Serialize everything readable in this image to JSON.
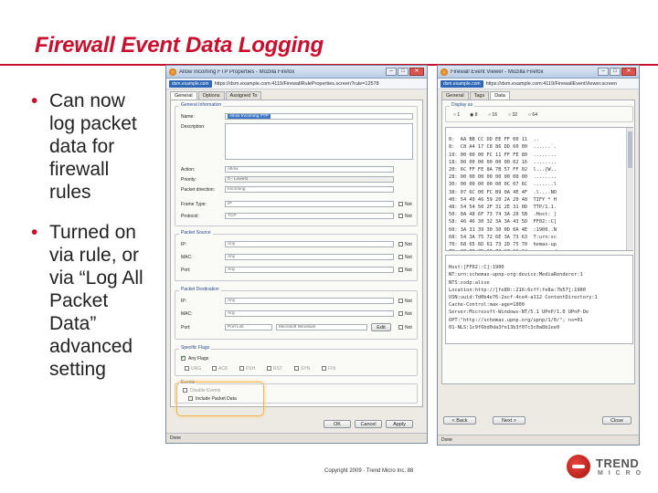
{
  "slide": {
    "title": "Firewall Event Data Logging",
    "bullets": [
      [
        "Can now",
        "log packet",
        "data for",
        "firewall",
        "rules"
      ],
      [
        "Turned on",
        "via rule, or",
        "via “Log All",
        "Packet",
        "Data”",
        "advanced",
        "setting"
      ]
    ],
    "copyright": "Copyright 2009 · Trend Micro Inc.   88",
    "logo": {
      "line1": "TREND",
      "line2": "M I C R O"
    }
  },
  "colors": {
    "accent": "#c8102e",
    "highlight": "#f0b44c"
  },
  "props_window": {
    "title": "Allow Incoming FTP Properties - Mozilla Firefox",
    "url_badge": "dsm.example.com",
    "url": "https://dsm.example.com:4119/FirewallRuleProperties.screen?rule=12578",
    "tabs": [
      "General",
      "Options",
      "Assigned To"
    ],
    "groups": {
      "general": "General Information",
      "source": "Packet Source",
      "destination": "Packet Destination",
      "flags": "Specific Flags",
      "events": "Events"
    },
    "fields": {
      "name_label": "Name:",
      "name_value": "Allow Incoming FTP",
      "desc_label": "Description:",
      "action_label": "Action:",
      "action_value": "Allow",
      "priority_label": "Priority:",
      "priority_value": "0 - Lowest",
      "direction_label": "Packet direction:",
      "direction_value": "Incoming",
      "frame_label": "Frame Type:",
      "frame_value": "IP",
      "protocol_label": "Protocol:",
      "protocol_value": "TCP",
      "not_label": "Not",
      "src_ip_label": "IP:",
      "src_ip_value": "Any",
      "src_mac_label": "MAC:",
      "src_mac_value": "Any",
      "src_port_label": "Port:",
      "src_port_value": "Any",
      "dst_ip_label": "IP:",
      "dst_ip_value": "Any",
      "dst_mac_label": "MAC:",
      "dst_mac_value": "Any",
      "dst_port_label": "Port:",
      "dst_port_value": "Port List",
      "dst_port_list": "Microsoft Windows",
      "edit_label": "Edit",
      "any_flags": "Any Flags",
      "flags": [
        "URG",
        "ACK",
        "PSH",
        "RST",
        "SYN",
        "FIN"
      ],
      "disable_events": "Disable Events",
      "include_packet_data": "Include Packet Data"
    },
    "buttons": {
      "ok": "OK",
      "cancel": "Cancel",
      "apply": "Apply"
    },
    "status": "Done"
  },
  "viewer_window": {
    "title": "Firewall Event Viewer - Mozilla Firefox",
    "url_badge": "dsm.example.com",
    "url": "https://dsm.example.com:4119/FirewallEventViewer.screen",
    "tabs": [
      "General",
      "Tags",
      "Data"
    ],
    "group_label": "Display as",
    "radios": [
      "1",
      "8",
      "16",
      "32",
      "64"
    ],
    "hex_lines": [
      "0:  AA BB CC DD EE FF 00 11  ..",
      "8:  C8 A4 17 C8 86 DD 60 00  ......`.",
      "10: 00 00 00 FC 11 FF FE 80  ........",
      "18: 00 00 00 00 00 00 02 16  ........",
      "20: 6C FF FE 8A 7B 57 FF 02  l...{W..",
      "28: 00 00 00 00 00 00 00 00  ........",
      "30: 00 00 00 00 00 0C 07 6C  .......l",
      "38: 07 6C 00 FC B9 0A 4E 4F  .l....NO",
      "40: 54 49 46 59 20 2A 20 48  TIFY * H",
      "48: 54 54 50 2F 31 2E 31 0D  TTP/1.1.",
      "50: 0A 48 6F 73 74 3A 20 5B  .Host: [",
      "58: 46 46 30 32 3A 3A 43 5D  FF02::C]",
      "60: 3A 31 39 30 30 0D 0A 4E  :1900..N",
      "68: 54 3A 75 72 6E 3A 73 63  T:urn:sc",
      "70: 68 65 6D 61 73 2D 75 70  hemas-up",
      "78: 6E 70 2D 6F 72 67 3A 64  np-org:d"
    ],
    "text_lines": [
      "Host:[FF02::C]:1900",
      "NT:urn:schemas-upnp-org:device:MediaRenderer:1",
      "NTS:ssdp:alive",
      "Location:http://[fe80::216:6cff:fe8a:7b57]:1900",
      "USN:uuid:7d0b4e76-2ecf-4ce4-a112 ContentDirectory:1",
      "Cache-Control:max-age=1800",
      "Server:Microsoft-Windows-NT/5.1 UPnP/1.0 UPnP-De",
      "OPT:\"http://schemas.upnp.org/upnp/1/0/\"; ns=01",
      "01-NLS:1c9f6bd0da3fe13b3f07c3c0a8b1ee0"
    ],
    "buttons": {
      "back": "< Back",
      "next": "Next >",
      "close": "Close"
    },
    "status": "Done"
  }
}
